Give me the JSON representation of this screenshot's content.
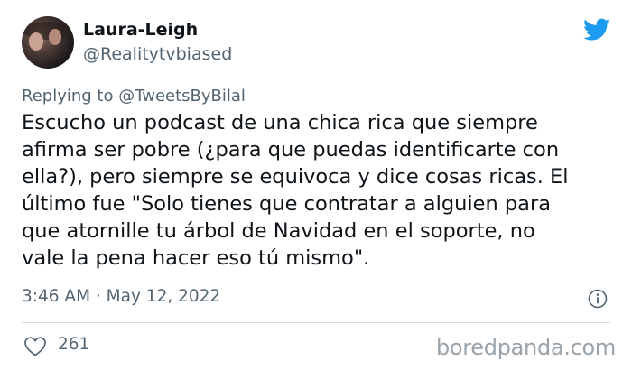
{
  "tweet": {
    "author_name": "Laura-Leigh",
    "author_handle": "@Realitytvbiased",
    "replying_prefix": "Replying to",
    "replying_to": "@TweetsByBilal",
    "text": "Escucho un podcast de una chica rica que siempre\nafirma ser pobre (¿para que puedas identificarte con\nella?), pero siempre se equivoca y dice cosas ricas. El\núltimo fue \"Solo tienes que contratar a alguien para\nque atornille tu árbol de Navidad en el soporte, no\nvale la pena hacer eso tú mismo\".",
    "timestamp": "3:46 AM · May 12, 2022",
    "likes": "261"
  },
  "watermark": "boredpanda.com",
  "icons": {
    "brand": "twitter-bird-icon",
    "info": "info-icon",
    "like": "heart-icon"
  },
  "colors": {
    "brand_blue": "#1d9bf0",
    "secondary_text": "#536471",
    "primary_text": "#0f1419"
  }
}
